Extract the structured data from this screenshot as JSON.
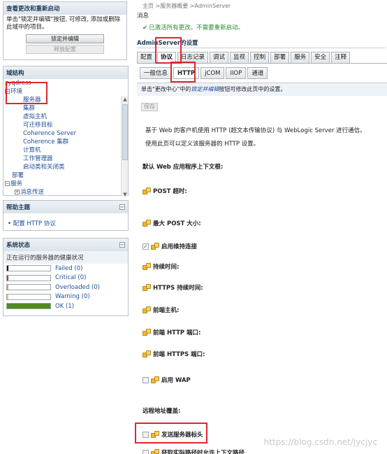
{
  "change_center": {
    "title": "查看更改和重新启动",
    "text": "单击\"锁定并编辑\"按钮, 可修改, 添加或删除此域中的项目。",
    "lock_button": "锁定并编辑",
    "release_button": "释放配置"
  },
  "domain_structure": {
    "title": "域结构",
    "domain": "zyqdress",
    "items": [
      {
        "label": "环境",
        "toggle": "□-"
      },
      {
        "label": "服务器"
      },
      {
        "label": "集群"
      },
      {
        "label": "虚拟主机"
      },
      {
        "label": "可迁移目标"
      },
      {
        "label": "Coherence Server"
      },
      {
        "label": "Coherence 集群"
      },
      {
        "label": "计算机"
      },
      {
        "label": "工作管理器"
      },
      {
        "label": "启动类和关闭类"
      },
      {
        "label": "部署"
      },
      {
        "label": "服务",
        "toggle": "□-"
      },
      {
        "label": "消息传送",
        "toggle": "⊞"
      }
    ]
  },
  "help": {
    "title": "帮助主题",
    "link": "配置 HTTP 协议"
  },
  "system_status": {
    "title": "系统状态",
    "subtitle": "正在运行的服务器的健康状况",
    "rows": [
      {
        "label": "Failed (0)",
        "color": "#000000",
        "fraction": 0
      },
      {
        "label": "Critical (0)",
        "color": "#d9302c",
        "fraction": 0
      },
      {
        "label": "Overloaded (0)",
        "color": "#e8a33a",
        "fraction": 0
      },
      {
        "label": "Warning (0)",
        "color": "#e8d33a",
        "fraction": 0
      },
      {
        "label": "OK (1)",
        "color": "#4e8a1f",
        "fraction": 1
      }
    ]
  },
  "breadcrumb": "主页 >服务器概要 >AdminServer",
  "messages": {
    "header": "消息",
    "ok": "已激活所有更改。不需要重新启动。"
  },
  "settings_title": "AdminServer的设置",
  "tabs": [
    "配置",
    "协议",
    "日志记录",
    "调试",
    "监视",
    "控制",
    "部署",
    "服务",
    "安全",
    "注释"
  ],
  "subtabs": [
    "一般信息",
    "HTTP",
    "jCOM",
    "IIOP",
    "通道"
  ],
  "info_bar": {
    "prefix": "单击\"更改中心\"中的",
    "link": "锁定并编辑",
    "suffix": "按钮可修改此页中的设置。"
  },
  "save_button": "保存",
  "description": [
    "基于 Web 的客户机使用 HTTP (超文本传输协议) 与 WebLogic Server 进行通信。",
    "使用此页可以定义该服务器的 HTTP 设置。"
  ],
  "fields": {
    "default_web_app_context": "默认 Web 应用程序上下文根:",
    "post_timeout": "POST 超时:",
    "max_post_size": "最大 POST 大小:",
    "enable_keepalive": "启用维持连接",
    "keepalive_duration": "持续时间:",
    "https_keepalive_duration": "HTTPS 持续时间:",
    "frontend_host": "前端主机:",
    "frontend_http_port": "前端 HTTP 端口:",
    "frontend_https_port": "前端 HTTPS 端口:",
    "enable_wap": "启用 WAP",
    "remote_address_override": "远程地址覆盖:",
    "send_server_header": "发送服务器标头",
    "last_partial": "获取实际路径时允许上下文路径"
  },
  "watermark": "https://blog.csdn.net/jycjyc"
}
